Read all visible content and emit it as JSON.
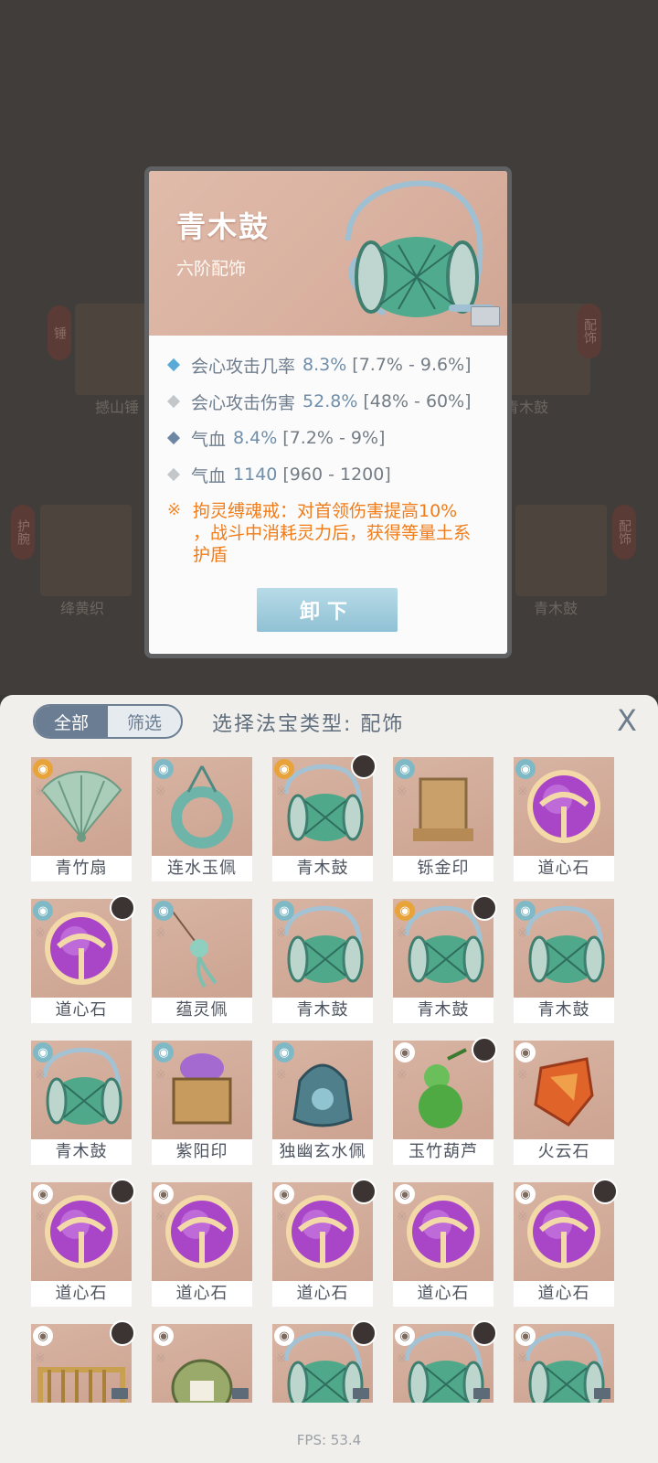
{
  "background": {
    "labels": [
      "撼山锤",
      "青木鼓",
      "绛黄织",
      "青木鼓"
    ],
    "tags": [
      "锤",
      "配饰",
      "护腕",
      "配饰"
    ]
  },
  "tooltip": {
    "title": "青木鼓",
    "subtitle": "六阶配饰",
    "stats": [
      {
        "name": "会心攻击几率",
        "value": "8.3%",
        "range": "[7.7% - 9.6%]",
        "color": "#5aaad8"
      },
      {
        "name": "会心攻击伤害",
        "value": "52.8%",
        "range": "[48% - 60%]",
        "color": "#c4c7ca"
      },
      {
        "name": "气血",
        "value": "8.4%",
        "range": "[7.2% - 9%]",
        "color": "#6d86a3"
      },
      {
        "name": "气血",
        "value": "1140",
        "range": "[960 - 1200]",
        "color": "#c4c7ca"
      }
    ],
    "effect_symbol": "※",
    "effect_line1": "拘灵缚魂戒：对首领伤害提高10%",
    "effect_line2": "，战斗中消耗灵力后，获得等量土系",
    "effect_line3": "护盾",
    "button_label": "卸下"
  },
  "panel": {
    "tab_all": "全部",
    "tab_filter": "筛选",
    "title": "选择法宝类型: 配饰",
    "close_symbol": "X"
  },
  "items": [
    {
      "name": "青竹扇",
      "icon": "fan-icon",
      "elem": "fire",
      "avatar": false
    },
    {
      "name": "连水玉佩",
      "icon": "jade-pendant-icon",
      "elem": "water",
      "avatar": false
    },
    {
      "name": "青木鼓",
      "icon": "drum-icon",
      "elem": "fire",
      "avatar": true
    },
    {
      "name": "铄金印",
      "icon": "seal-icon",
      "elem": "water",
      "avatar": false
    },
    {
      "name": "道心石",
      "icon": "orb-icon",
      "elem": "water",
      "avatar": false
    },
    {
      "name": "道心石",
      "icon": "orb-icon",
      "elem": "water",
      "avatar": true
    },
    {
      "name": "蕴灵佩",
      "icon": "pendant-icon",
      "elem": "water",
      "avatar": false
    },
    {
      "name": "青木鼓",
      "icon": "drum-icon",
      "elem": "water",
      "avatar": false
    },
    {
      "name": "青木鼓",
      "icon": "drum-icon",
      "elem": "fire",
      "avatar": true
    },
    {
      "name": "青木鼓",
      "icon": "drum-icon",
      "elem": "water",
      "avatar": false
    },
    {
      "name": "青木鼓",
      "icon": "drum-icon",
      "elem": "water",
      "avatar": false
    },
    {
      "name": "紫阳印",
      "icon": "box-seal-icon",
      "elem": "water",
      "avatar": false
    },
    {
      "name": "独幽玄水佩",
      "icon": "water-pendant-icon",
      "elem": "water",
      "avatar": false
    },
    {
      "name": "玉竹葫芦",
      "icon": "gourd-icon",
      "elem": "white",
      "avatar": true
    },
    {
      "name": "火云石",
      "icon": "fire-stone-icon",
      "elem": "white",
      "avatar": false
    },
    {
      "name": "道心石",
      "icon": "orb-icon",
      "elem": "white",
      "avatar": true
    },
    {
      "name": "道心石",
      "icon": "orb-icon",
      "elem": "white",
      "avatar": false
    },
    {
      "name": "道心石",
      "icon": "orb-icon",
      "elem": "white",
      "avatar": true
    },
    {
      "name": "道心石",
      "icon": "orb-icon",
      "elem": "white",
      "avatar": false
    },
    {
      "name": "道心石",
      "icon": "orb-icon",
      "elem": "white",
      "avatar": true
    },
    {
      "name": "",
      "icon": "rings-icon",
      "elem": "white",
      "avatar": true
    },
    {
      "name": "",
      "icon": "medicine-bag-icon",
      "elem": "white",
      "avatar": false
    },
    {
      "name": "",
      "icon": "drum-icon",
      "elem": "white",
      "avatar": true
    },
    {
      "name": "",
      "icon": "drum-icon",
      "elem": "white",
      "avatar": true
    },
    {
      "name": "",
      "icon": "drum-icon",
      "elem": "white",
      "avatar": false
    }
  ],
  "fps": "FPS: 53.4"
}
